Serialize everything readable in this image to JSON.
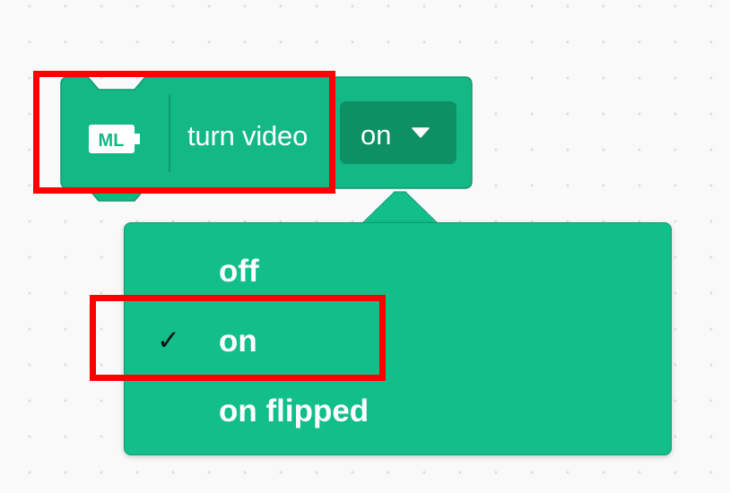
{
  "block": {
    "label": "turn video",
    "dropdown_value": "on",
    "icon": "ml-extension-icon",
    "icon_text": "ML",
    "caret_icon": "caret-down-icon",
    "colors": {
      "fill": "#13b885",
      "border": "#0d9a6f",
      "dropdown": "#0e8f64",
      "text": "#ffffff"
    }
  },
  "menu": {
    "items": [
      {
        "label": "off",
        "selected": false
      },
      {
        "label": "on",
        "selected": true
      },
      {
        "label": "on flipped",
        "selected": false
      }
    ],
    "check_glyph": "✓",
    "check_icon": "checkmark-icon",
    "colors": {
      "background": "#12be8a",
      "text": "#ffffff",
      "check": "#111111"
    }
  },
  "highlight": {
    "color": "#ff0000",
    "targets": [
      "block-head",
      "menu-item-on"
    ]
  }
}
